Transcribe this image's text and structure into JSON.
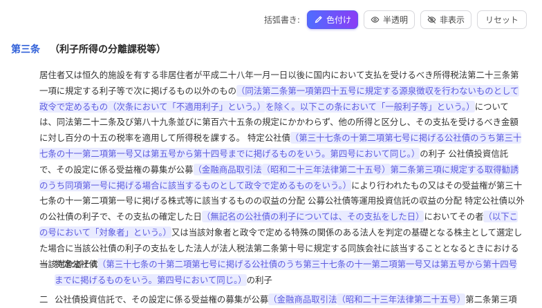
{
  "toolbar": {
    "label": "括弧書き:",
    "buttons": [
      {
        "label": "色付け",
        "icon": "pen-icon",
        "active": true
      },
      {
        "label": "半透明",
        "icon": "eye-icon",
        "active": false
      },
      {
        "label": "非表示",
        "icon": "eye-off-icon",
        "active": false
      },
      {
        "label": "リセット",
        "icon": "",
        "active": false
      }
    ]
  },
  "article": {
    "number": "第三条",
    "title": "（利子所得の分離課税等）"
  },
  "paragraph": [
    [
      {
        "t": "居住者又は恒久的施設を有する非居住者が平成二十八年一月一日以後に国内において支払を受けるべき所得税法第二十三条第"
      }
    ],
    [
      {
        "t": "一項に規定する利子等で次に掲げるもの以外のもの"
      },
      {
        "t": "（同法第二条第一項第四十五号に規定する源泉徴収を行わないものとして",
        "h": true
      }
    ],
    [
      {
        "t": "政令で定めるもの",
        "h": true
      },
      {
        "t": "（次条において「不適用利子」という。）",
        "h": true
      },
      {
        "t": "を除く。以下この条において「一般利子等」という。）",
        "h": true
      },
      {
        "t": "について"
      }
    ],
    [
      {
        "t": "は、同法第二十二条及び第八十九条並びに第百六十五条の規定にかかわらず、他の所得と区分し、その支払を受けるべき金額"
      }
    ],
    [
      {
        "t": "に対し百分の十五の税率を適用して所得税を課する。 特定公社債"
      },
      {
        "t": "（第三十七条の十第二項第七号に掲げる公社債のうち第三十",
        "h": true
      }
    ],
    [
      {
        "t": "七条の十一第二項第一号又は第五号から第十四号までに掲げるものをいう。第四号において同じ。）",
        "h": true
      },
      {
        "t": "の利子 公社債投資信託"
      }
    ],
    [
      {
        "t": "で、その設定に係る受益権の募集が公募"
      },
      {
        "t": "（金融商品取引法",
        "h": true
      },
      {
        "t": "（昭和二十三年法律第二十五号）",
        "h": true
      },
      {
        "t": "第二条第三項に規定する取得勧誘",
        "h": true
      }
    ],
    [
      {
        "t": "のうち同項第一号に掲げる場合に該当するものとして政令で定めるものをいう。）",
        "h": true
      },
      {
        "t": "により行われたもの又はその受益権が第三十"
      }
    ],
    [
      {
        "t": "七条の十一第二項第一号に掲げる株式等に該当するものの収益の分配 公募公社債等運用投資信託の収益の分配 特定公社債以外"
      }
    ],
    [
      {
        "t": "の公社債の利子で、その支払の確定した日"
      },
      {
        "t": "（無記名の公社債の利子については、その支払をした日）",
        "h": true
      },
      {
        "t": "においてその者"
      },
      {
        "t": "（以下こ",
        "h": true
      }
    ],
    [
      {
        "t": "の号において「対象者」という。）",
        "h": true
      },
      {
        "t": "又は当該対象者と政令で定める特殊の関係のある法人を判定の基礎となる株主として選定し"
      }
    ],
    [
      {
        "t": "た場合に当該公社債の利子の支払をした法人が法人税法第二条第十号に規定する同族会社に該当することとなるときにおける"
      }
    ],
    [
      {
        "t": "当該対象者その他の政令で定める者が支払を受けるもの"
      }
    ]
  ],
  "items": [
    {
      "num": "一",
      "lines": [
        [
          {
            "t": "特定公社債"
          },
          {
            "t": "（第三十七条の十第二項第七号に掲げる公社債のうち第三十七条の十一第二項第一号又は第五号から第十四号",
            "h": true
          }
        ],
        [
          {
            "t": "までに掲げるものをいう。第四号において同じ。）",
            "h": true
          },
          {
            "t": "の利子"
          }
        ]
      ]
    },
    {
      "num": "二",
      "lines": [
        [
          {
            "t": "公社債投資信託で、その設定に係る受益権の募集が公募"
          },
          {
            "t": "（金融商品取引法",
            "h": true
          },
          {
            "t": "（昭和二十三年法律第二十五号）",
            "h": true
          },
          {
            "t": "第二条第三項"
          }
        ]
      ]
    }
  ]
}
